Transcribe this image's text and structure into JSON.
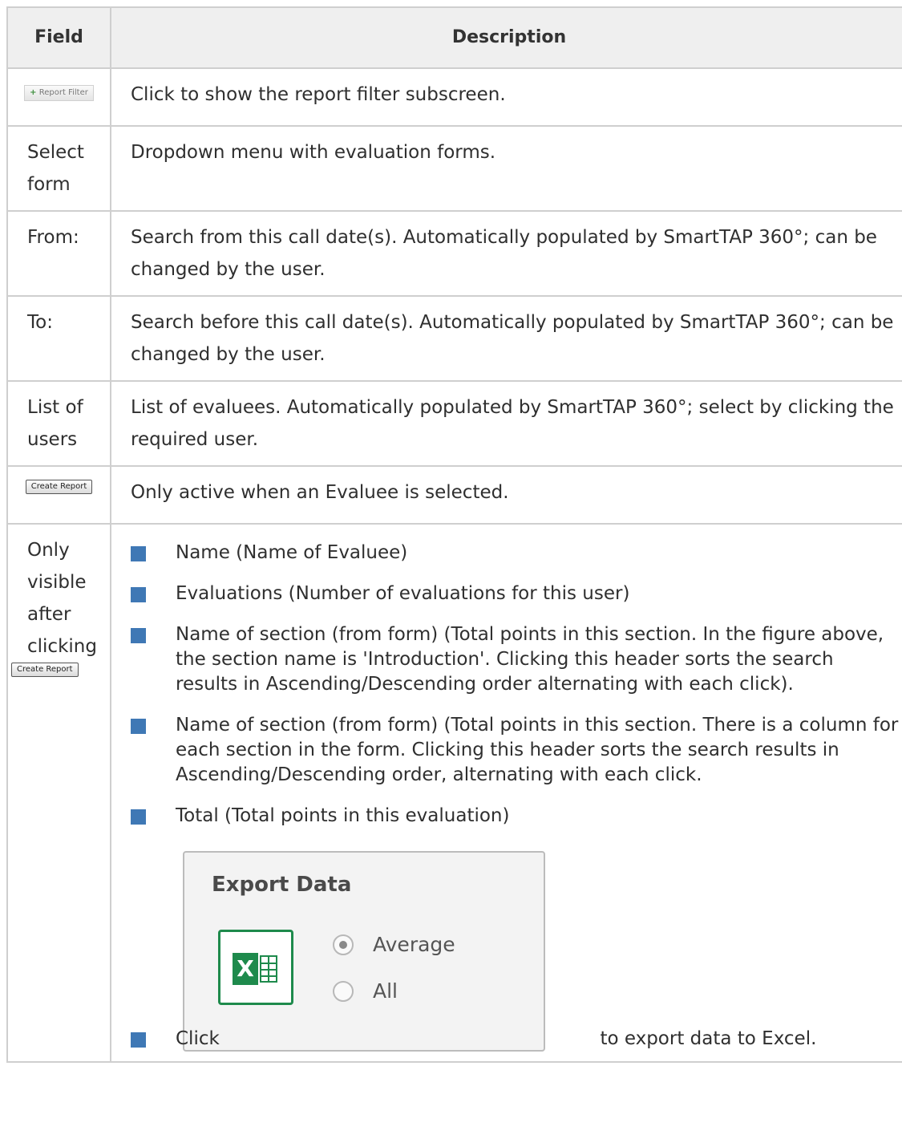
{
  "table": {
    "headers": {
      "field": "Field",
      "description": "Description"
    },
    "rows": {
      "report_filter": {
        "field_button": "Report Filter",
        "description": "Click to show the report filter subscreen."
      },
      "select_form": {
        "field": "Select form",
        "description": "Dropdown menu with evaluation forms."
      },
      "from": {
        "field": "From:",
        "description": "Search from this call date(s). Automatically populated by SmartTAP 360°; can be changed by the user."
      },
      "to": {
        "field": "To:",
        "description": "Search before this call date(s). Automatically populated by SmartTAP 360°; can be changed by the user."
      },
      "list_of_users": {
        "field": "List of users",
        "description": "List of evaluees. Automatically populated by SmartTAP 360°; select by clicking the required user."
      },
      "create_report": {
        "field_button": "Create Report",
        "description": "Only active when an Evaluee is selected."
      },
      "visible_after": {
        "field": "Only visible after clicking",
        "field_button": "Create Report",
        "bullets": [
          "Name (Name of Evaluee)",
          "Evaluations (Number of evaluations for this user)",
          "Name of section (from form) (Total points in this section. In the figure above, the section name is 'Introduction'. Clicking this header sorts the search results in Ascending/Descending order alternating with each click).",
          "Name of section (from form) (Total points in this section. There is a column for each section in the form. Clicking this header sorts the search results in Ascending/Descending order, alternating with each click.",
          "Total (Total points in this evaluation)"
        ],
        "export_panel": {
          "title": "Export Data",
          "icon": "excel-icon",
          "options": [
            {
              "label": "Average",
              "selected": true
            },
            {
              "label": "All",
              "selected": false
            }
          ]
        },
        "click_prefix": "Click",
        "click_suffix": "to export data to Excel."
      }
    }
  },
  "colors": {
    "bullet": "#3f78b5",
    "header_bg": "#efefef",
    "border": "#cfcfcf",
    "excel_green": "#1e8a4c"
  }
}
